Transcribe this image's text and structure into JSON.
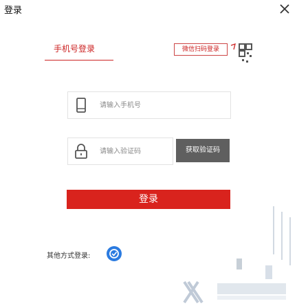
{
  "window": {
    "title": "登录",
    "close_label": "×"
  },
  "tabs": {
    "phone_login": "手机号登录",
    "qr_login": "微信扫码登录"
  },
  "phone_field": {
    "placeholder": "请输入手机号",
    "value": ""
  },
  "code_field": {
    "placeholder": "请输入验证码",
    "value": ""
  },
  "send_code_button": "获取验证码",
  "login_button": "登录",
  "other_methods_label": "其他方式登录:",
  "colors": {
    "accent": "#d9231d",
    "send_code_bg": "#5f5f5f",
    "other_icon": "#2b7be0"
  }
}
